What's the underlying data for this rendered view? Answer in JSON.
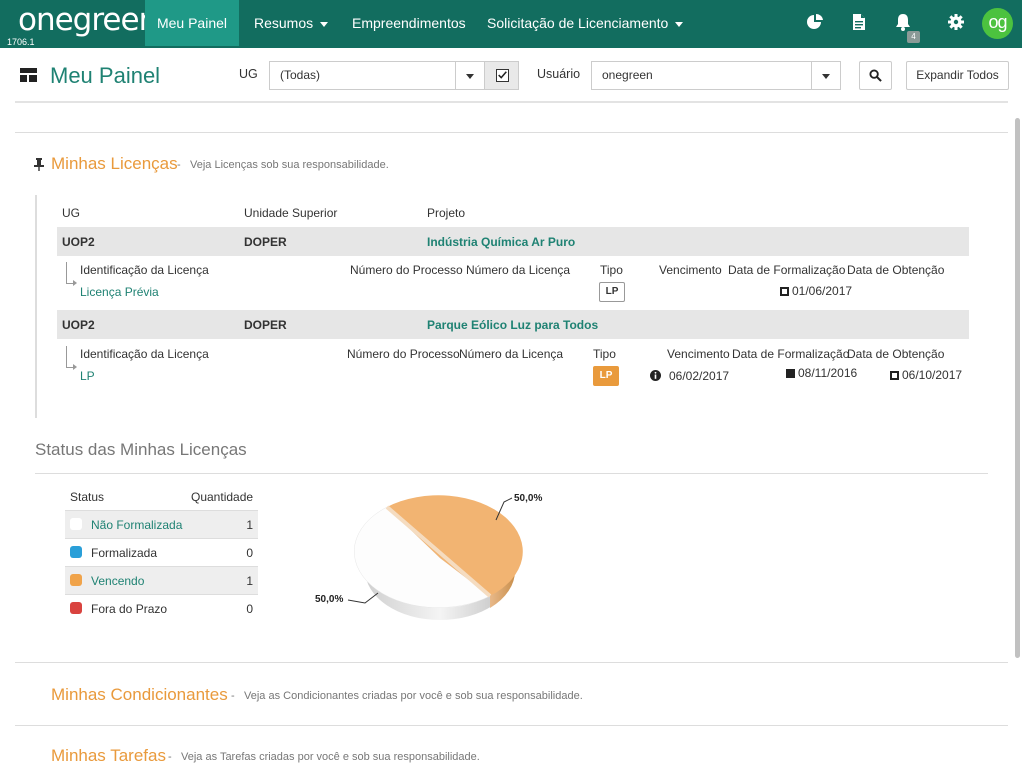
{
  "app": {
    "logo": "onegreen",
    "version": "1706.1",
    "avatar": "og",
    "notification_count": "4"
  },
  "nav": {
    "items": [
      {
        "label": "Meu Painel"
      },
      {
        "label": "Resumos"
      },
      {
        "label": "Empreendimentos"
      },
      {
        "label": "Solicitação de Licenciamento"
      }
    ]
  },
  "toolbar": {
    "title": "Meu Painel",
    "ug_label": "UG",
    "ug_value": "(Todas)",
    "user_label": "Usuário",
    "user_value": "onegreen",
    "expand_label": "Expandir Todos"
  },
  "licencas": {
    "title": "Minhas Licenças",
    "separator": "-",
    "description": "Veja Licenças sob sua responsabilidade.",
    "headers": {
      "ug": "UG",
      "unidade": "Unidade Superior",
      "projeto": "Projeto"
    },
    "detail_headers": {
      "identificacao": "Identificação da Licença",
      "num_processo": "Número do Processo",
      "num_licenca": "Número da Licença",
      "tipo": "Tipo",
      "vencimento": "Vencimento",
      "formalizacao": "Data de Formalização",
      "obtencao": "Data de Obtenção"
    },
    "groups": [
      {
        "ug": "UOP2",
        "unidade": "DOPER",
        "projeto": "Indústria Química Ar Puro",
        "licenca": {
          "identificacao": "Licença Prévia",
          "tipo": "LP",
          "vencimento": "",
          "formalizacao": "01/06/2017",
          "obtencao": ""
        }
      },
      {
        "ug": "UOP2",
        "unidade": "DOPER",
        "projeto": "Parque Eólico Luz para Todos",
        "licenca": {
          "identificacao": "LP",
          "tipo": "LP",
          "vencimento": "06/02/2017",
          "formalizacao": "08/11/2016",
          "obtencao": "06/10/2017"
        }
      }
    ]
  },
  "status": {
    "title": "Status das Minhas Licenças",
    "col_status": "Status",
    "col_qtd": "Quantidade",
    "rows": [
      {
        "name": "Não Formalizada",
        "qty": "1",
        "color": "#ffffff"
      },
      {
        "name": "Formalizada",
        "qty": "0",
        "color": "#2a9fd8"
      },
      {
        "name": "Vencendo",
        "qty": "1",
        "color": "#f0a34a"
      },
      {
        "name": "Fora do Prazo",
        "qty": "0",
        "color": "#d9433f"
      }
    ],
    "pie": {
      "label_a": "50,0%",
      "label_b": "50,0%"
    }
  },
  "chart_data": {
    "type": "pie",
    "categories": [
      "Não Formalizada",
      "Vencendo"
    ],
    "values": [
      50.0,
      50.0
    ],
    "title": ""
  },
  "condicionantes": {
    "title": "Minhas Condicionantes",
    "separator": "-",
    "description": "Veja as Condicionantes criadas por você e sob sua responsabilidade."
  },
  "tarefas": {
    "title": "Minhas Tarefas",
    "separator": "-",
    "description": "Veja as Tarefas criadas por você e sob sua responsabilidade."
  }
}
